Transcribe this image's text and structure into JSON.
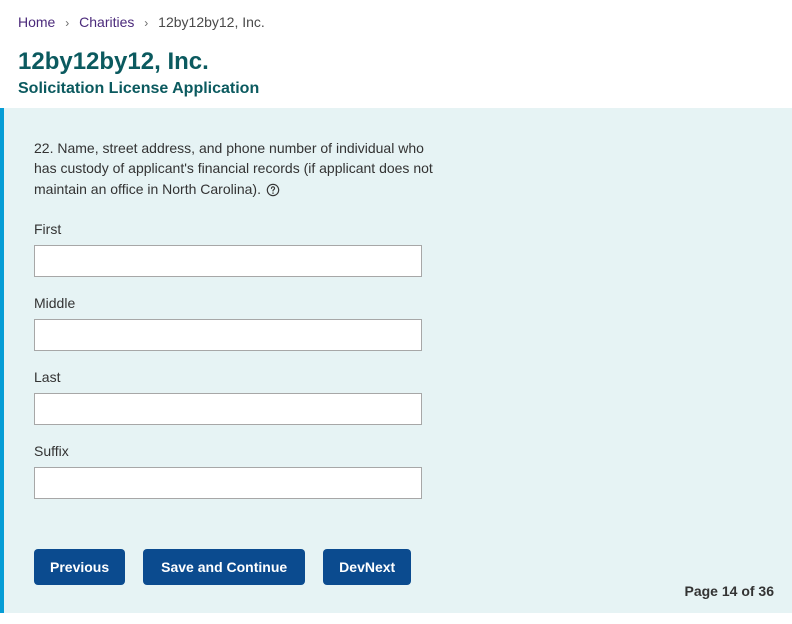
{
  "breadcrumb": {
    "home": "Home",
    "charities": "Charities",
    "current": "12by12by12, Inc."
  },
  "header": {
    "title": "12by12by12, Inc.",
    "subtitle": "Solicitation License Application"
  },
  "question": {
    "text": "22. Name, street address, and phone number of individual who has custody of applicant's financial records (if applicant does not maintain an office in North Carolina)."
  },
  "fields": {
    "first": {
      "label": "First",
      "value": ""
    },
    "middle": {
      "label": "Middle",
      "value": ""
    },
    "last": {
      "label": "Last",
      "value": ""
    },
    "suffix": {
      "label": "Suffix",
      "value": ""
    }
  },
  "buttons": {
    "previous": "Previous",
    "save": "Save and Continue",
    "devnext": "DevNext"
  },
  "pager": {
    "label": "Page 14 of 36"
  }
}
